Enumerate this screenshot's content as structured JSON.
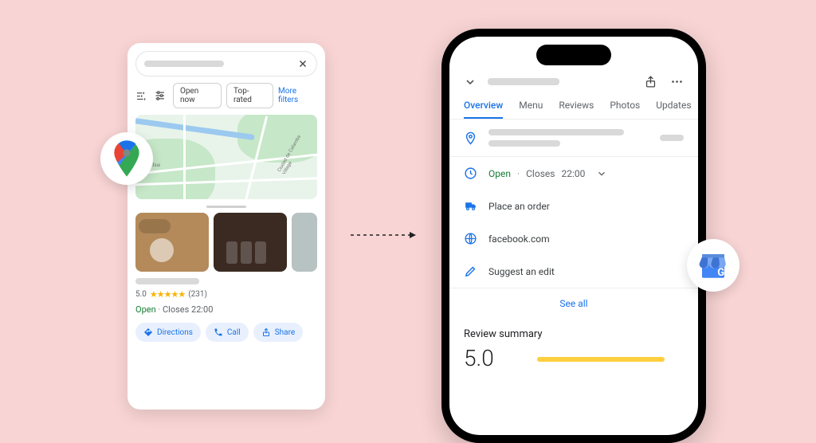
{
  "maps": {
    "filters": {
      "open_now": "Open now",
      "top_rated": "Top-rated",
      "more": "More filters"
    },
    "map_labels": {
      "a": "Claudius",
      "b": "Ciudad de Calamba Village"
    },
    "rating": {
      "score": "5.0",
      "stars": "★★★★★",
      "count": "(231)"
    },
    "hours": {
      "open": "Open",
      "sep": "·",
      "closes": "Closes 22:00"
    },
    "actions": {
      "directions": "Directions",
      "call": "Call",
      "share": "Share"
    }
  },
  "listing": {
    "tabs": {
      "overview": "Overview",
      "menu": "Menu",
      "reviews": "Reviews",
      "photos": "Photos",
      "updates": "Updates"
    },
    "hours": {
      "open": "Open",
      "sep": "·",
      "closes": "Closes",
      "time": "22:00"
    },
    "order": "Place an order",
    "website": "facebook.com",
    "suggest": "Suggest an edit",
    "see_all": "See all",
    "review_summary": {
      "title": "Review summary",
      "score": "5.0"
    }
  }
}
